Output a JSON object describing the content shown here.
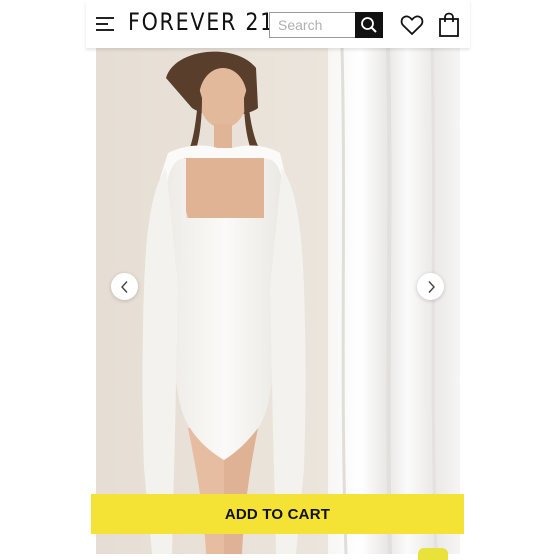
{
  "header": {
    "brand": "FOREVER 21",
    "search": {
      "placeholder": "Search",
      "value": ""
    },
    "icons": [
      "menu-icon",
      "search-icon",
      "heart-icon",
      "shopping-bag-icon"
    ]
  },
  "product": {
    "image_icon": "product-photo",
    "carousel": {
      "prev_icon": "chevron-left-icon",
      "next_icon": "chevron-right-icon"
    }
  },
  "cart": {
    "label": "ADD TO CART"
  },
  "colors": {
    "accent": "#f4e234",
    "header_bg": "#ffffff",
    "search_button": "#111111"
  }
}
